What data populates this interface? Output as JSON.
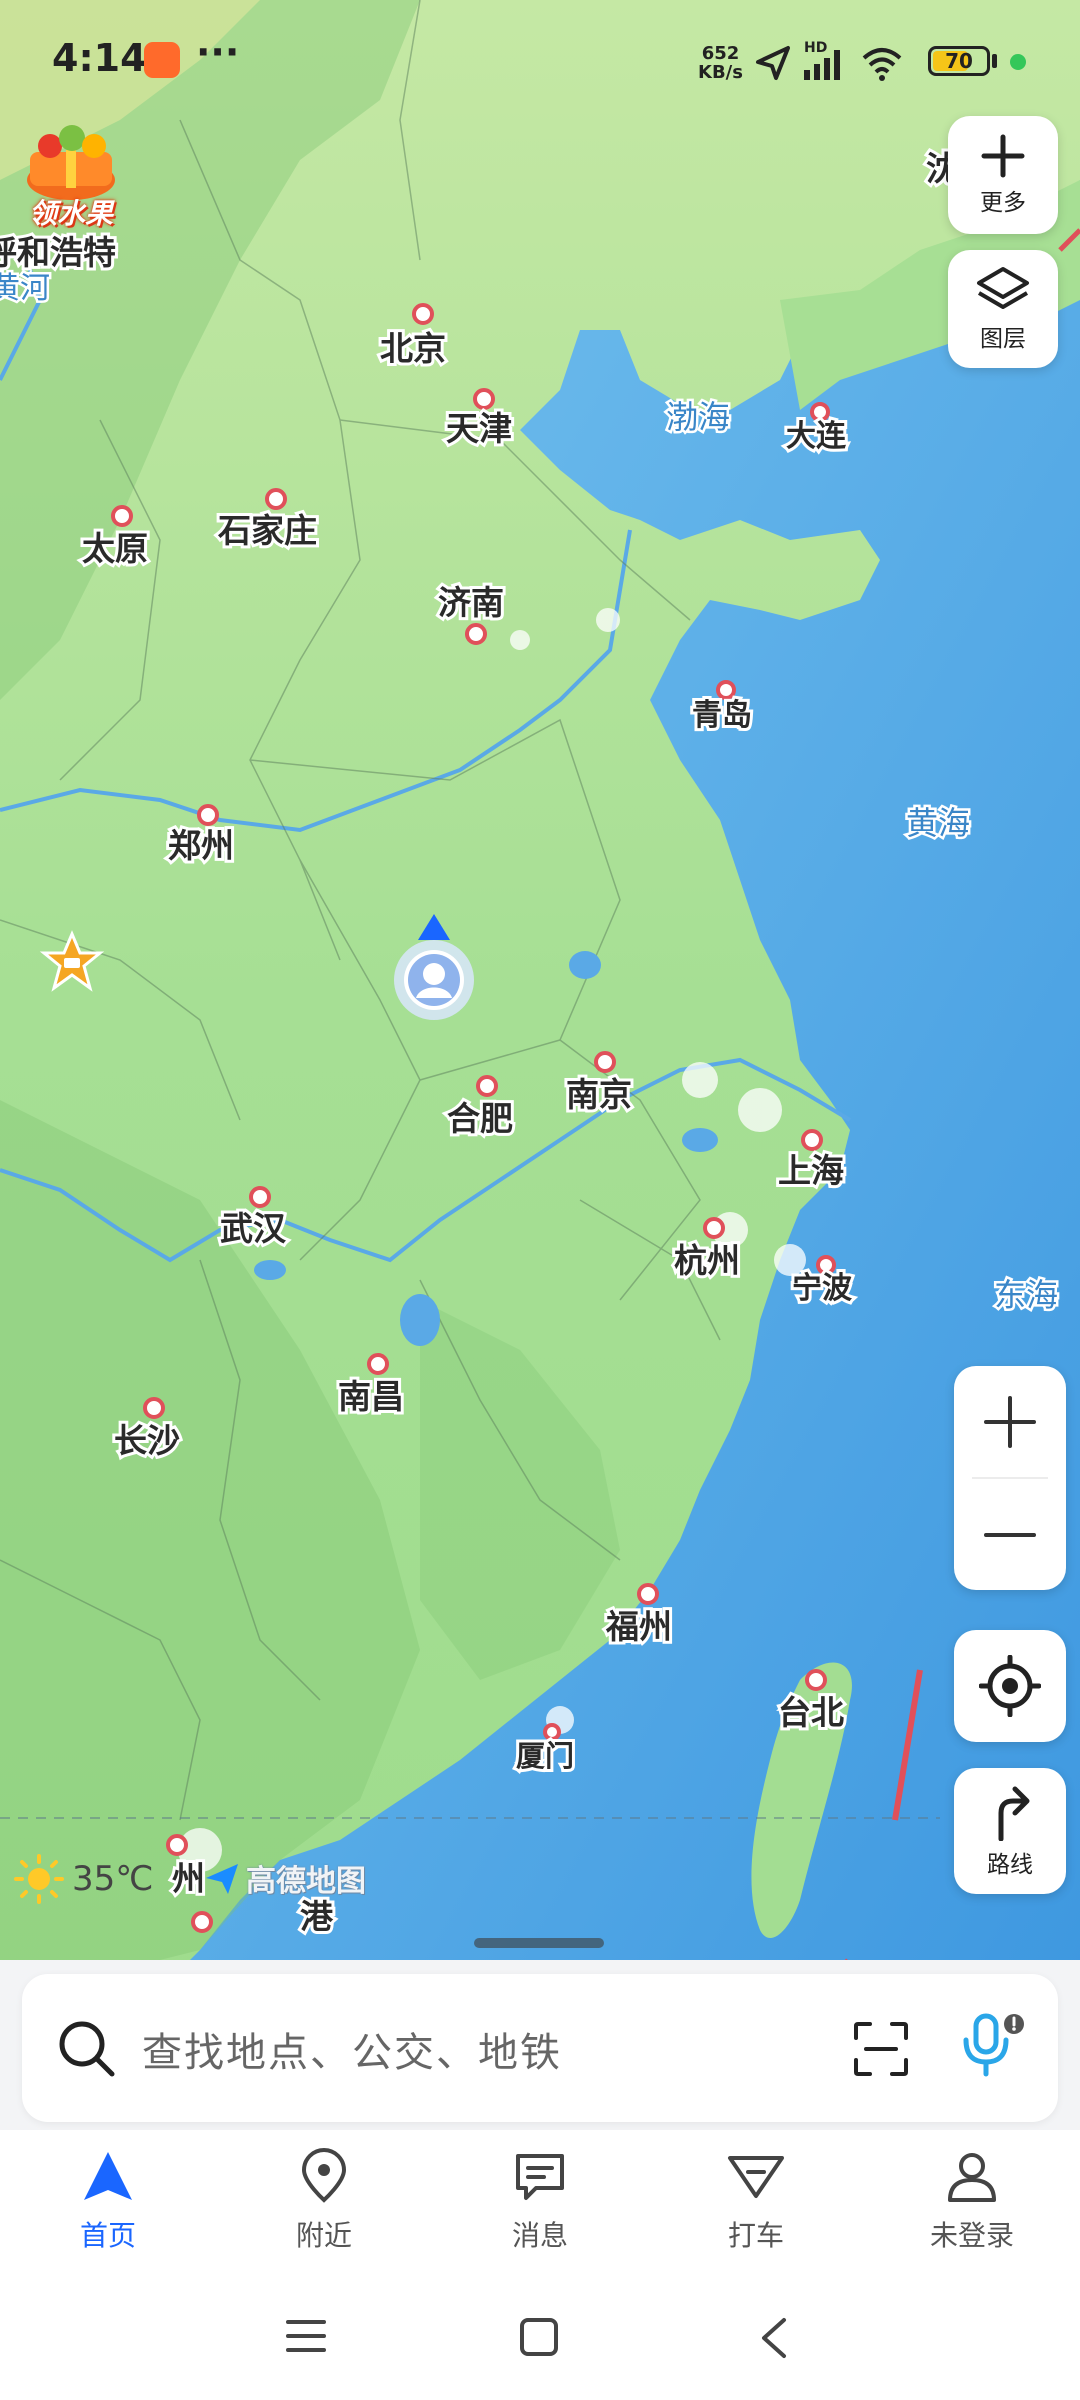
{
  "status_bar": {
    "time": "4:14",
    "dots": "···",
    "net_speed_value": "652",
    "net_speed_unit": "KB/s",
    "network_type": "HD",
    "battery_percent": 70,
    "battery_label": "70"
  },
  "promo": {
    "label": "领水果"
  },
  "controls": {
    "more_label": "更多",
    "layers_label": "图层",
    "route_label": "路线"
  },
  "weather": {
    "temperature": "35℃"
  },
  "brand": {
    "name": "高德地图"
  },
  "search": {
    "placeholder": "查找地点、公交、地铁"
  },
  "nav": {
    "items": [
      {
        "label": "首页",
        "icon": "home-arrow-icon",
        "active": true
      },
      {
        "label": "附近",
        "icon": "location-pin-icon",
        "active": false
      },
      {
        "label": "消息",
        "icon": "message-icon",
        "active": false
      },
      {
        "label": "打车",
        "icon": "taxi-icon",
        "active": false
      },
      {
        "label": "未登录",
        "icon": "user-icon",
        "active": false
      }
    ]
  },
  "map": {
    "cities": [
      {
        "name": "北京"
      },
      {
        "name": "天津"
      },
      {
        "name": "石家庄"
      },
      {
        "name": "太原"
      },
      {
        "name": "济南"
      },
      {
        "name": "大连"
      },
      {
        "name": "青岛"
      },
      {
        "name": "郑州"
      },
      {
        "name": "合肥"
      },
      {
        "name": "南京"
      },
      {
        "name": "上海"
      },
      {
        "name": "武汉"
      },
      {
        "name": "杭州"
      },
      {
        "name": "宁波"
      },
      {
        "name": "南昌"
      },
      {
        "name": "长沙"
      },
      {
        "name": "福州"
      },
      {
        "name": "台北"
      },
      {
        "name": "厦门"
      },
      {
        "name": "州"
      },
      {
        "name": "港"
      }
    ],
    "partial_labels": {
      "hohhot": "呼和浩特",
      "yellow_river": "黄河",
      "top_right": "沈"
    },
    "seas": [
      {
        "name": "渤海"
      },
      {
        "name": "黄海"
      },
      {
        "name": "东海"
      }
    ],
    "colors": {
      "land": "#a8e09a",
      "sea": "#5db4ea",
      "river": "#5aa9e6",
      "accent": "#1a66ff"
    }
  }
}
